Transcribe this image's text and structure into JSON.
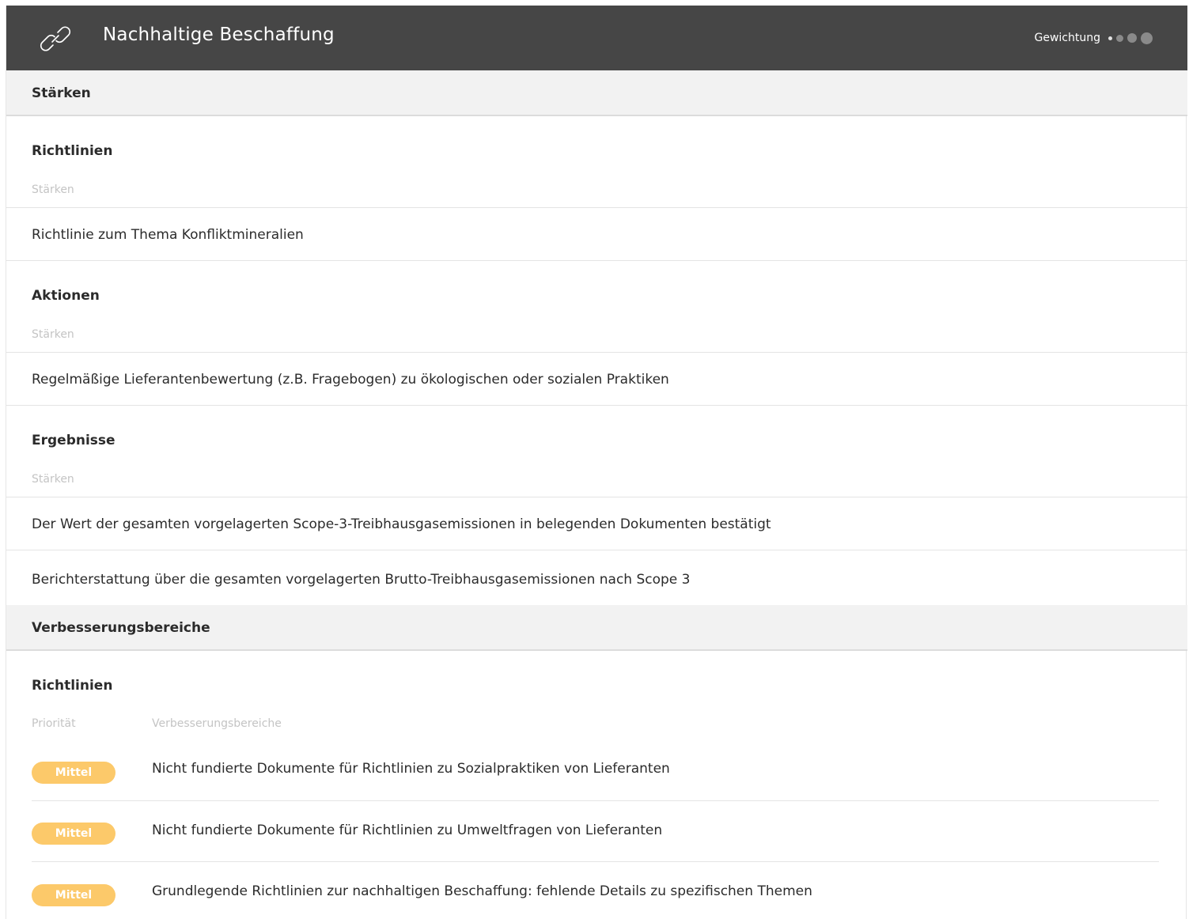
{
  "header": {
    "title": "Nachhaltige Beschaffung",
    "icon": "link-icon",
    "weight_label": "Gewichtung",
    "weight_level": "1 of 4"
  },
  "strengths": {
    "title": "Stärken",
    "groups": [
      {
        "title": "Richtlinien",
        "sub_label": "Stärken",
        "items": [
          "Richtlinie zum Thema Konfliktmineralien"
        ]
      },
      {
        "title": "Aktionen",
        "sub_label": "Stärken",
        "items": [
          "Regelmäßige Lieferantenbewertung (z.B. Fragebogen) zu ökologischen oder sozialen Praktiken"
        ]
      },
      {
        "title": "Ergebnisse",
        "sub_label": "Stärken",
        "items": [
          "Der Wert der gesamten vorgelagerten Scope-3-Treibhausgasemissionen in belegenden Dokumenten bestätigt",
          "Berichterstattung über die gesamten vorgelagerten Brutto-Treibhausgasemissionen nach Scope 3"
        ]
      }
    ]
  },
  "improvements": {
    "title": "Verbesserungsbereiche",
    "groups": [
      {
        "title": "Richtlinien",
        "col_priority": "Priorität",
        "col_area": "Verbesserungsbereiche",
        "items": [
          {
            "priority": "Mittel",
            "text": "Nicht fundierte Dokumente für Richtlinien zu Sozialpraktiken von Lieferanten"
          },
          {
            "priority": "Mittel",
            "text": "Nicht fundierte Dokumente für Richtlinien zu Umweltfragen von Lieferanten"
          },
          {
            "priority": "Mittel",
            "text": "Grundlegende Richtlinien zur nachhaltigen Beschaffung: fehlende Details zu spezifischen Themen"
          }
        ]
      }
    ]
  },
  "colors": {
    "header_bg": "#464646",
    "section_bg": "#f2f2f2",
    "badge_medium": "#fcc96a"
  }
}
